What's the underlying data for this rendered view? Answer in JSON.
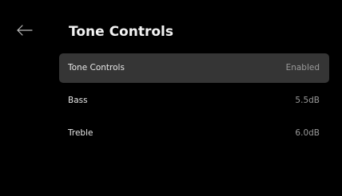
{
  "header": {
    "back_icon": "arrow-left-icon",
    "title": "Tone Controls"
  },
  "settings": {
    "items": [
      {
        "label": "Tone Controls",
        "value": "Enabled",
        "focused": true
      },
      {
        "label": "Bass",
        "value": "5.5dB",
        "focused": false
      },
      {
        "label": "Treble",
        "value": "6.0dB",
        "focused": false
      }
    ]
  },
  "colors": {
    "background": "#000000",
    "focused_row": "#353535",
    "label": "#e6e6e6",
    "value": "#9a9a9a"
  }
}
